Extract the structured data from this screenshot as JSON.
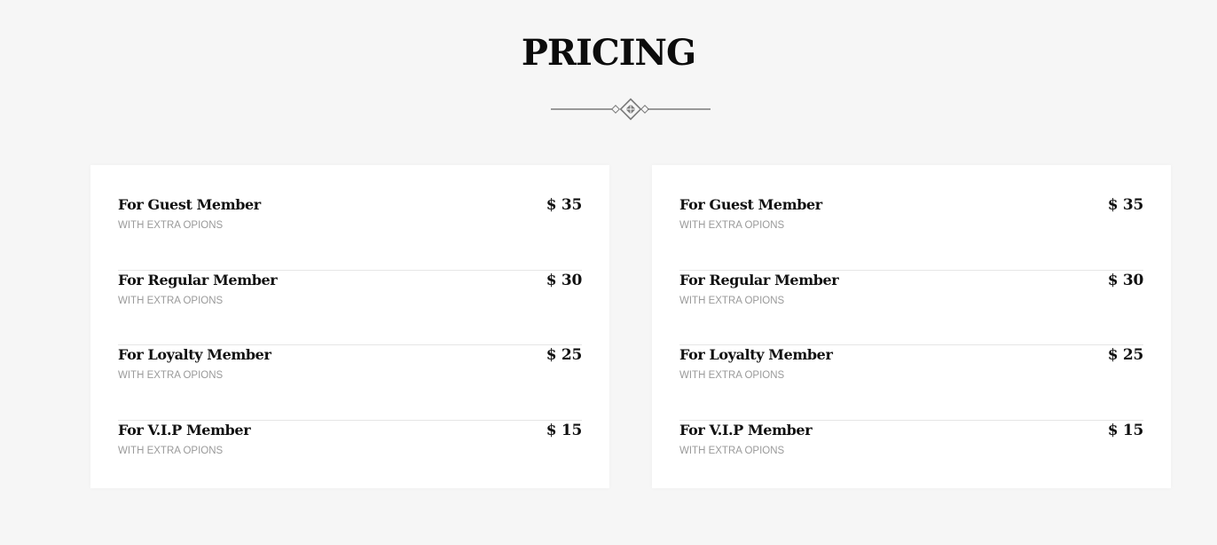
{
  "section": {
    "title": "PRICING"
  },
  "cards": [
    {
      "items": [
        {
          "name": "For Guest Member",
          "subtitle": "WITH EXTRA OPIONS",
          "price": "$ 35"
        },
        {
          "name": "For Regular Member",
          "subtitle": "WITH EXTRA OPIONS",
          "price": "$ 30"
        },
        {
          "name": "For Loyalty Member",
          "subtitle": "WITH EXTRA OPIONS",
          "price": "$ 25"
        },
        {
          "name": "For V.I.P Member",
          "subtitle": "WITH EXTRA OPIONS",
          "price": "$ 15"
        }
      ]
    },
    {
      "items": [
        {
          "name": "For Guest Member",
          "subtitle": "WITH EXTRA OPIONS",
          "price": "$ 35"
        },
        {
          "name": "For Regular Member",
          "subtitle": "WITH EXTRA OPIONS",
          "price": "$ 30"
        },
        {
          "name": "For Loyalty Member",
          "subtitle": "WITH EXTRA OPIONS",
          "price": "$ 25"
        },
        {
          "name": "For V.I.P Member",
          "subtitle": "WITH EXTRA OPIONS",
          "price": "$ 15"
        }
      ]
    }
  ],
  "colors": {
    "background": "#f6f6f6",
    "card": "#ffffff",
    "text": "#111111",
    "muted": "#9a9a9a",
    "divider_line": "#e6e6e6",
    "ornament": "#7a7a7a"
  },
  "icons": {
    "divider": "diamond-ornament-icon"
  }
}
